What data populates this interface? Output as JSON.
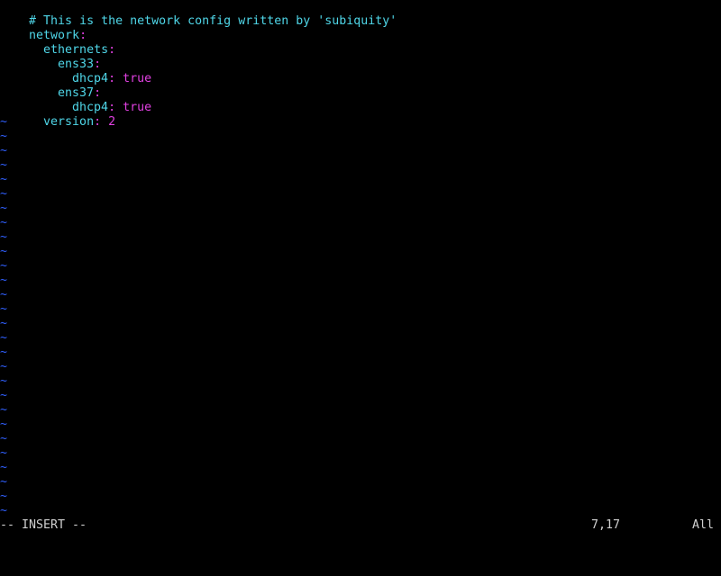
{
  "editor": {
    "comment": "# This is the network config written by 'subiquity'",
    "lines": {
      "network": {
        "key": "network",
        "colon": ":"
      },
      "ethernets": {
        "key": "ethernets",
        "colon": ":"
      },
      "ens33": {
        "key": "ens33",
        "colon": ":"
      },
      "ens33_dhcp4": {
        "key": "dhcp4",
        "colon": ":",
        "value": " true"
      },
      "ens37": {
        "key": "ens37",
        "colon": ":"
      },
      "ens37_dhcp4": {
        "key": "dhcp4",
        "colon": ":",
        "value": " true"
      },
      "version": {
        "key": "version",
        "colon": ":",
        "value": " 2"
      }
    },
    "empty_line_marker": "~",
    "empty_line_count": 28
  },
  "status": {
    "mode": "-- INSERT --",
    "cursor_position": "7,17",
    "scroll_indicator": "All"
  },
  "colors": {
    "background": "#000000",
    "comment_and_keys": "#4fd6e8",
    "colons_and_values": "#e040e0",
    "tilde": "#3060ff",
    "status_text": "#d0d0d0"
  }
}
